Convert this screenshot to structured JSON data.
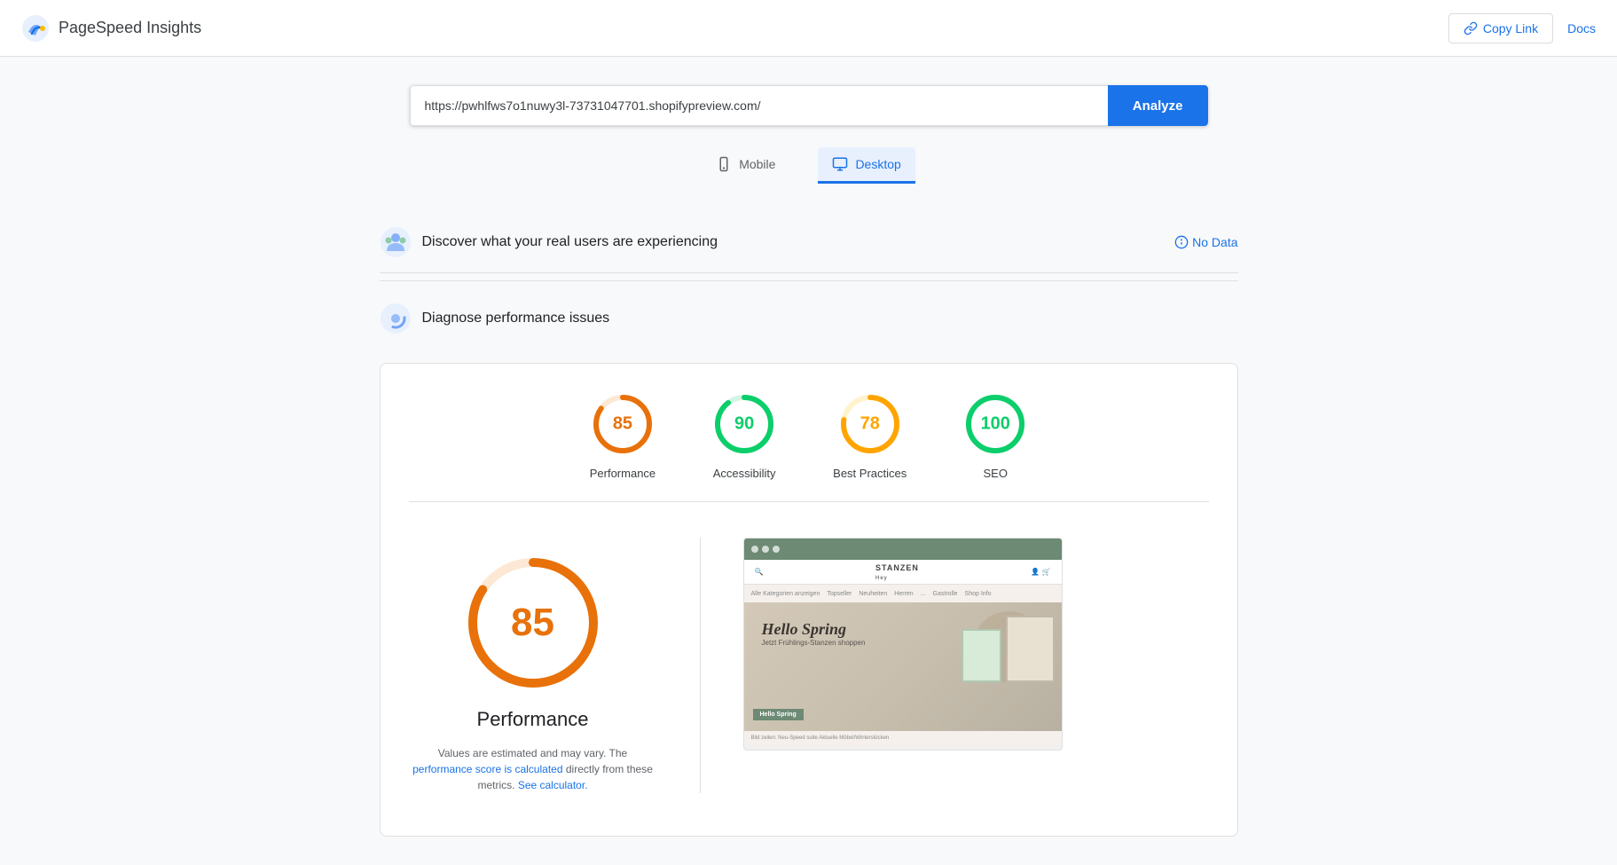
{
  "header": {
    "app_name": "PageSpeed Insights",
    "copy_link_label": "Copy Link",
    "docs_label": "Docs"
  },
  "url_bar": {
    "value": "https://pwhlfws7o1nuwy3l-73731047701.shopifypreview.com/",
    "placeholder": "Enter a web page URL",
    "analyze_label": "Analyze"
  },
  "tabs": [
    {
      "id": "mobile",
      "label": "Mobile",
      "icon": "mobile-icon",
      "active": false
    },
    {
      "id": "desktop",
      "label": "Desktop",
      "icon": "desktop-icon",
      "active": true
    }
  ],
  "sections": {
    "real_users": {
      "title": "Discover what your real users are experiencing",
      "no_data_label": "No Data"
    },
    "diagnose": {
      "title": "Diagnose performance issues"
    }
  },
  "scores": [
    {
      "id": "performance",
      "value": 85,
      "label": "Performance",
      "color": "#e8710a",
      "track_color": "#fce8d4",
      "pct": 85
    },
    {
      "id": "accessibility",
      "value": 90,
      "label": "Accessibility",
      "color": "#0cce6b",
      "track_color": "#d2f5e3",
      "pct": 90
    },
    {
      "id": "best_practices",
      "value": 78,
      "label": "Best Practices",
      "color": "#ffa400",
      "track_color": "#fff3cd",
      "pct": 78
    },
    {
      "id": "seo",
      "value": 100,
      "label": "SEO",
      "color": "#0cce6b",
      "track_color": "#d2f5e3",
      "pct": 100
    }
  ],
  "performance_detail": {
    "score": 85,
    "title": "Performance",
    "note_text": "Values are estimated and may vary. The",
    "note_link1_text": "performance score is calculated",
    "note_link1_href": "#",
    "note_middle": "directly from these metrics.",
    "note_link2_text": "See calculator.",
    "note_link2_href": "#",
    "big_score_color": "#e8710a",
    "circle_color": "#e8710a",
    "circle_track_color": "#fce8d4"
  },
  "screenshot": {
    "site_name": "STANZEN",
    "tagline": "Hey",
    "hero_title": "Hello Spring",
    "hero_subtitle": "Jetzt Frühlings-Stanzen shoppen",
    "badge_text": "Hello Spring"
  }
}
